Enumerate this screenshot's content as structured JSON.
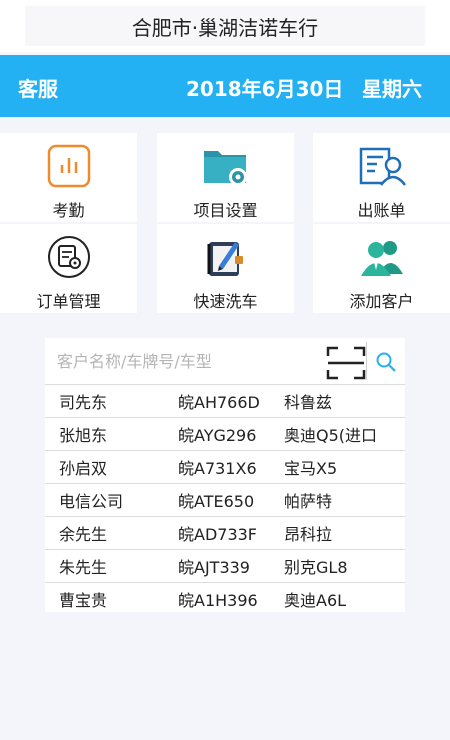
{
  "titlebar": {
    "title": "合肥市·巢湖洁诺车行"
  },
  "topbar": {
    "role": "客服",
    "date": "2018年6月30日",
    "weekday": "星期六"
  },
  "menu": [
    {
      "label": "考勤",
      "icon": "bar-chart-icon"
    },
    {
      "label": "项目设置",
      "icon": "folder-gear-icon"
    },
    {
      "label": "出账单",
      "icon": "person-card-icon"
    },
    {
      "label": "订单管理",
      "icon": "document-gear-icon"
    },
    {
      "label": "快速洗车",
      "icon": "notebook-pen-icon"
    },
    {
      "label": "添加客户",
      "icon": "add-customer-icon"
    }
  ],
  "search": {
    "placeholder": "客户名称/车牌号/车型"
  },
  "customers": [
    {
      "name": "司先东",
      "plate": "皖AH766D",
      "model": "科鲁兹"
    },
    {
      "name": "张旭东",
      "plate": "皖AYG296",
      "model": "奥迪Q5(进口"
    },
    {
      "name": "孙启双",
      "plate": "皖A731X6",
      "model": "宝马X5"
    },
    {
      "name": "电信公司",
      "plate": "皖ATE650",
      "model": "帕萨特"
    },
    {
      "name": "余先生",
      "plate": "皖AD733F",
      "model": "昂科拉"
    },
    {
      "name": "朱先生",
      "plate": "皖AJT339",
      "model": "别克GL8"
    },
    {
      "name": "曹宝贵",
      "plate": "皖A1H396",
      "model": "奥迪A6L"
    }
  ]
}
